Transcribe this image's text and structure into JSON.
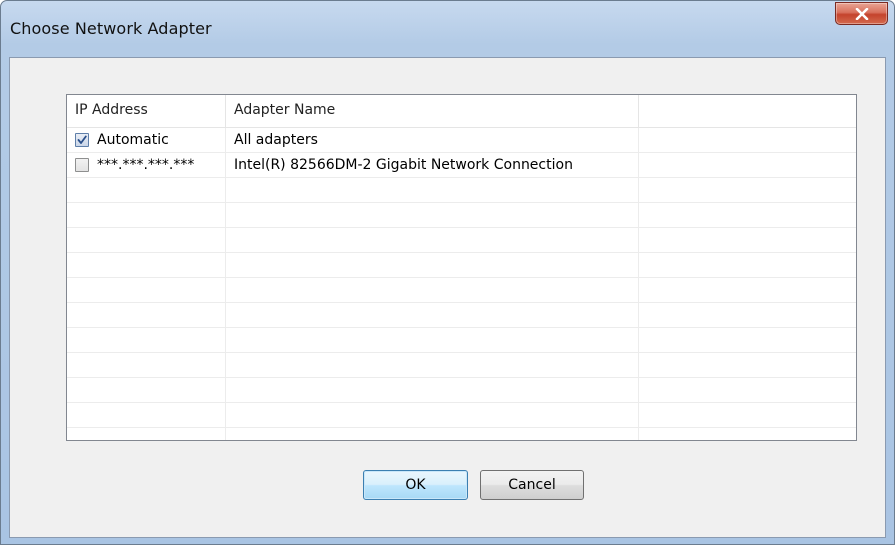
{
  "window": {
    "title": "Choose Network Adapter",
    "close_symbol": "X"
  },
  "listview": {
    "columns": [
      "IP Address",
      "Adapter Name",
      ""
    ],
    "rows": [
      {
        "checked": true,
        "ip": "Automatic",
        "name": "All adapters"
      },
      {
        "checked": false,
        "ip": "***.***.***.***",
        "name": "Intel(R) 82566DM-2 Gigabit Network Connection"
      }
    ]
  },
  "buttons": {
    "ok_label": "OK",
    "cancel_label": "Cancel"
  },
  "icons": {
    "close": "close-icon",
    "checkbox_checked": "checkmark-icon"
  },
  "colors": {
    "close_button": "#c4432c",
    "default_button_border": "#3c7fb1"
  }
}
